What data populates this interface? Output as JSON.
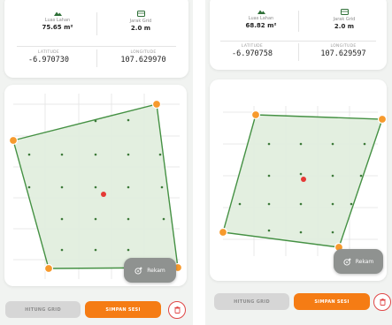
{
  "screens": [
    {
      "metrics": {
        "area_label": "Luas Lahan",
        "area_value": "75.65 m²",
        "grid_label": "Jarak Grid",
        "grid_value": "2.0 m"
      },
      "latitude_label": "LATITUDE",
      "latitude_value": "-6.970730",
      "longitude_label": "LONGITUDE",
      "longitude_value": "107.629970",
      "rekam_label": "Rekam",
      "hitung_grid_label": "HITUNG GRID",
      "simpan_sesi_label": "SIMPAN SESI"
    },
    {
      "metrics": {
        "area_label": "Luas Lahan",
        "area_value": "68.82 m²",
        "grid_label": "Jarak Grid",
        "grid_value": "2.0 m"
      },
      "latitude_label": "LATITUDE",
      "latitude_value": "-6.970758",
      "longitude_label": "LONGITUDE",
      "longitude_value": "107.629597",
      "rekam_label": "Rekam",
      "hitung_grid_label": "HITUNG GRID",
      "simpan_sesi_label": "SIMPAN SESI"
    }
  ],
  "colors": {
    "accent_orange": "#f57c14",
    "polygon_green": "#3c8c3a",
    "polygon_fill": "#e2efdf",
    "current_location_red": "#e53935",
    "trash_red": "#e04646"
  },
  "icons": {
    "area": "field-area-icon",
    "grid": "grid-spacing-icon",
    "rekam": "record-location-icon",
    "trash": "trash-icon"
  }
}
